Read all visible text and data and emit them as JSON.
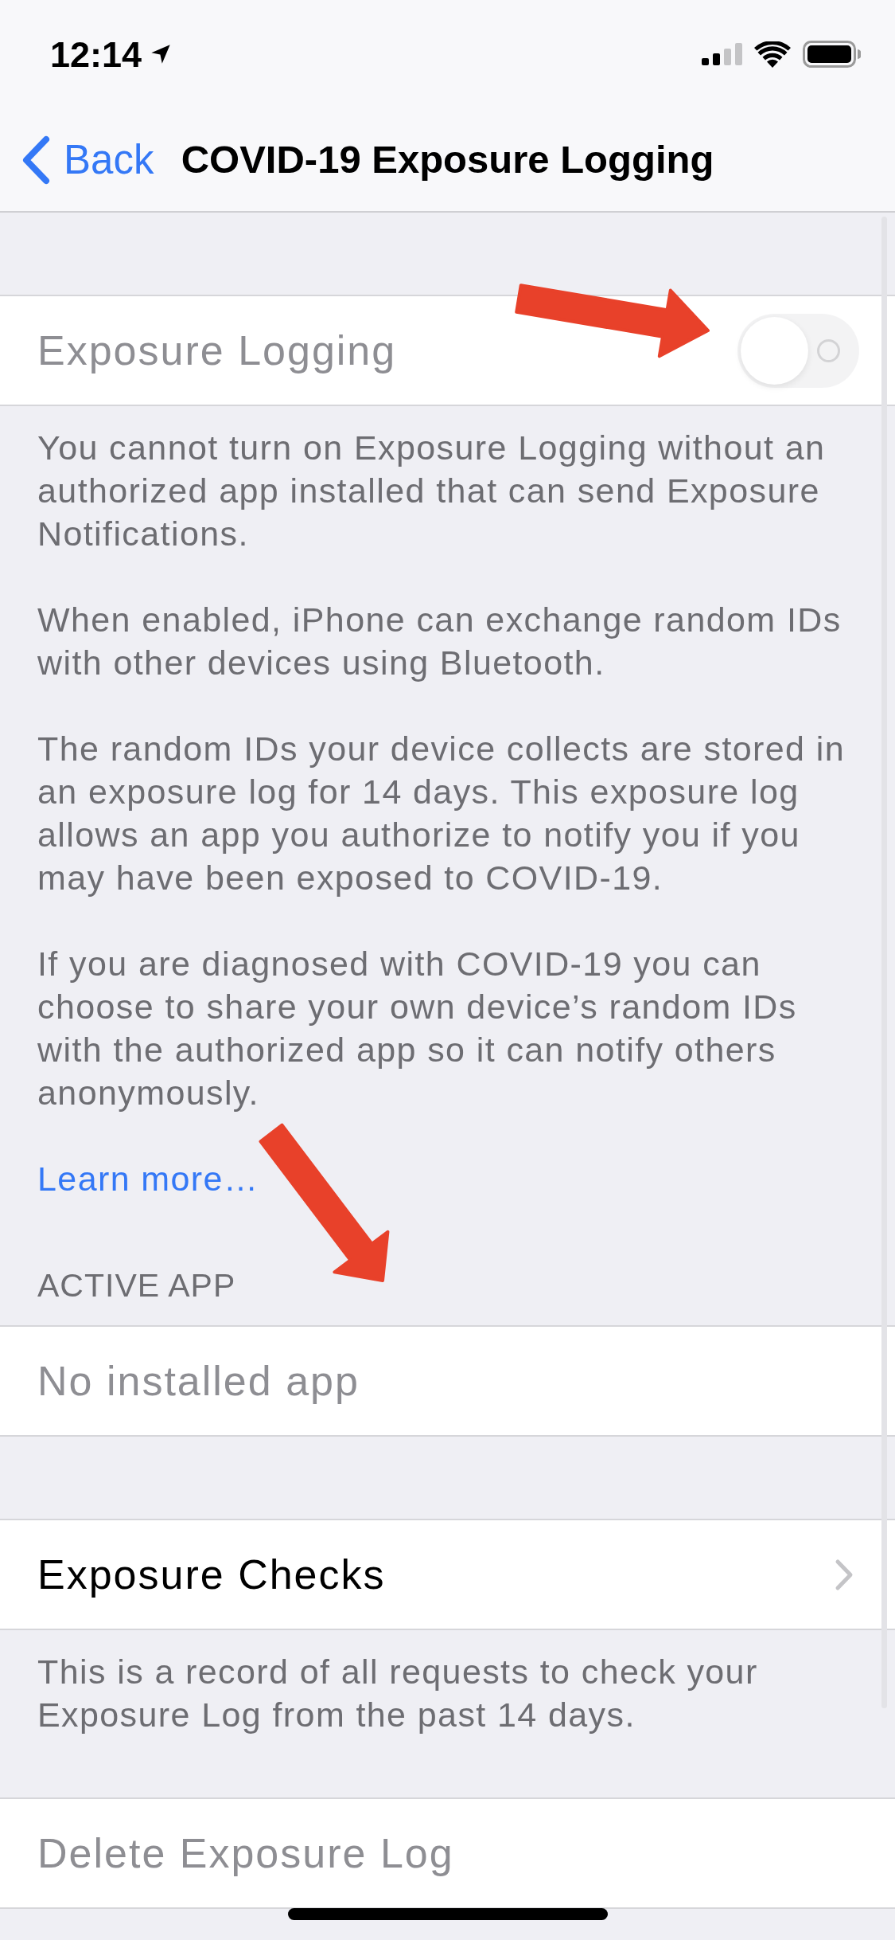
{
  "status_bar": {
    "time": "12:14"
  },
  "nav_bar": {
    "back": "Back",
    "title": "COVID-19 Exposure Logging"
  },
  "sections": [
    {
      "rows": [
        {
          "kind": "toggle",
          "label": "Exposure Logging",
          "on": false,
          "disabled": true
        }
      ],
      "footer": [
        "You cannot turn on Exposure Logging without an authorized app installed that can send Exposure Notifications.",
        "When enabled, iPhone can exchange random IDs with other devices using Bluetooth.",
        "The random IDs your device collects are stored in an exposure log for 14 days. This exposure log allows an app you authorize to notify you if you may have been exposed to COVID-19.",
        "If you are diagnosed with COVID-19 you can choose to share your own device’s random IDs with the authorized app so it can notify others anonymously."
      ],
      "footer_link": "Learn more…"
    },
    {
      "header": "ACTIVE APP",
      "rows": [
        {
          "kind": "text",
          "label": "No installed app",
          "disabled": true
        }
      ]
    },
    {
      "rows": [
        {
          "kind": "disclosure",
          "label": "Exposure Checks",
          "disabled": false
        }
      ],
      "footer": [
        "This is a record of all requests to check your Exposure Log from the past 14 days."
      ]
    },
    {
      "rows": [
        {
          "kind": "button",
          "label": "Delete Exposure Log",
          "disabled": true
        }
      ]
    }
  ],
  "annotations": [
    {
      "kind": "arrow"
    },
    {
      "kind": "arrow"
    }
  ]
}
